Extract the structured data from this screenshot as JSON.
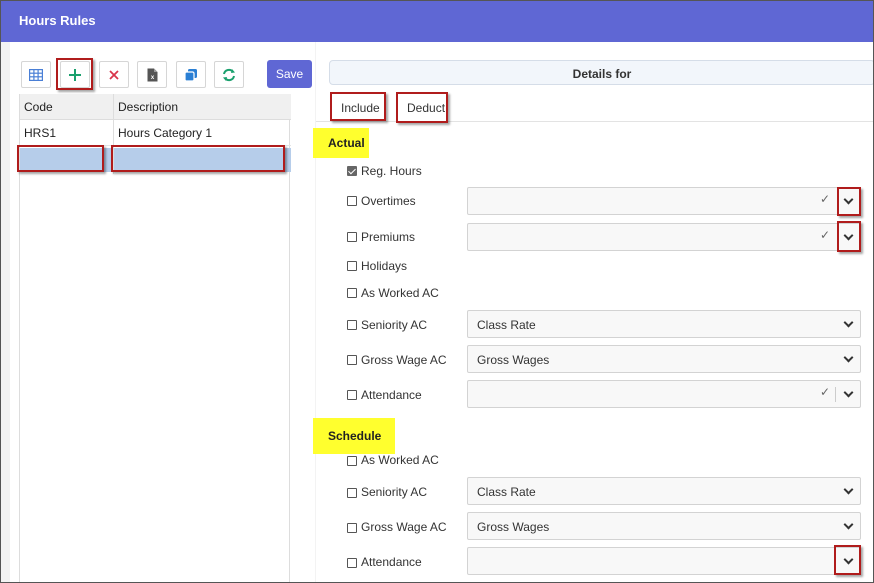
{
  "window": {
    "title": "Hours Rules"
  },
  "toolbar": {
    "buttons": [
      {
        "name": "grid-view-icon",
        "color": "#4a7fd6"
      },
      {
        "name": "plus-icon",
        "color": "#1aa06d"
      },
      {
        "name": "close-icon",
        "color": "#d9344a"
      },
      {
        "name": "excel-export-icon",
        "color": "#555555"
      },
      {
        "name": "copy-icon",
        "color": "#2a7fd4"
      },
      {
        "name": "refresh-icon",
        "color": "#1aa06d"
      }
    ],
    "save_label": "Save"
  },
  "grid": {
    "headers": {
      "code": "Code",
      "description": "Description"
    },
    "rows": [
      {
        "code": "HRS1",
        "description": "Hours Category 1"
      },
      {
        "code": "",
        "description": ""
      }
    ]
  },
  "details": {
    "header": "Details for",
    "tabs": [
      "Include",
      "Deduct"
    ],
    "actual": {
      "title": "Actual",
      "items": [
        {
          "label": "Reg. Hours",
          "checked": true
        },
        {
          "label": "Overtimes",
          "checked": false,
          "value": ""
        },
        {
          "label": "Premiums",
          "checked": false,
          "value": ""
        },
        {
          "label": "Holidays",
          "checked": false
        },
        {
          "label": "As Worked AC",
          "checked": false
        },
        {
          "label": "Seniority AC",
          "checked": false,
          "value": "Class Rate"
        },
        {
          "label": "Gross Wage AC",
          "checked": false,
          "value": "Gross Wages"
        },
        {
          "label": "Attendance",
          "checked": false,
          "value": ""
        }
      ]
    },
    "schedule": {
      "title": "Schedule",
      "items": [
        {
          "label": "As Worked AC",
          "checked": false
        },
        {
          "label": "Seniority AC",
          "checked": false,
          "value": "Class Rate"
        },
        {
          "label": "Gross Wage AC",
          "checked": false,
          "value": "Gross Wages"
        },
        {
          "label": "Attendance",
          "checked": false,
          "value": ""
        }
      ]
    }
  },
  "colors": {
    "titlebar": "#5f67d4",
    "highlight": "#ffff2e",
    "annotation": "#b01c1c",
    "selected_row": "#b6cdea"
  }
}
